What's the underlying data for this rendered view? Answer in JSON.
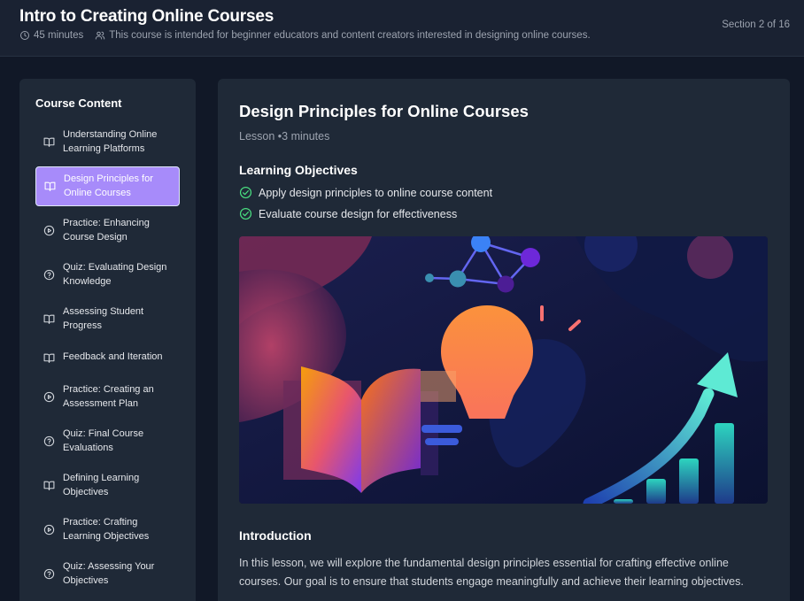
{
  "header": {
    "title": "Intro to Creating Online Courses",
    "duration": "45 minutes",
    "audience": "This course is intended for beginner educators and content creators interested in designing online courses.",
    "section_indicator": "Section 2 of 16"
  },
  "sidebar": {
    "title": "Course Content",
    "items": [
      {
        "label": "Understanding Online Learning Platforms",
        "icon": "book-icon",
        "active": false
      },
      {
        "label": "Design Principles for Online Courses",
        "icon": "book-icon",
        "active": true
      },
      {
        "label": "Practice: Enhancing Course Design",
        "icon": "play-icon",
        "active": false
      },
      {
        "label": "Quiz: Evaluating Design Knowledge",
        "icon": "question-icon",
        "active": false
      },
      {
        "label": "Assessing Student Progress",
        "icon": "book-icon",
        "active": false
      },
      {
        "label": "Feedback and Iteration",
        "icon": "book-icon",
        "active": false
      },
      {
        "label": "Practice: Creating an Assessment Plan",
        "icon": "play-icon",
        "active": false
      },
      {
        "label": "Quiz: Final Course Evaluations",
        "icon": "question-icon",
        "active": false
      },
      {
        "label": "Defining Learning Objectives",
        "icon": "book-icon",
        "active": false
      },
      {
        "label": "Practice: Crafting Learning Objectives",
        "icon": "play-icon",
        "active": false
      },
      {
        "label": "Quiz: Assessing Your Objectives",
        "icon": "question-icon",
        "active": false
      }
    ]
  },
  "main": {
    "lesson_title": "Design Principles for Online Courses",
    "lesson_meta": "Lesson •3 minutes",
    "objectives_heading": "Learning Objectives",
    "objectives": [
      "Apply design principles to online course content",
      "Evaluate course design for effectiveness"
    ],
    "intro_heading": "Introduction",
    "intro_text": "In this lesson, we will explore the fundamental design principles essential for crafting effective online courses. Our goal is to ensure that students engage meaningfully and achieve their learning objectives."
  },
  "colors": {
    "background": "#111827",
    "panel": "#1f2937",
    "active_item": "#a78bfa",
    "check": "#4ade80"
  }
}
